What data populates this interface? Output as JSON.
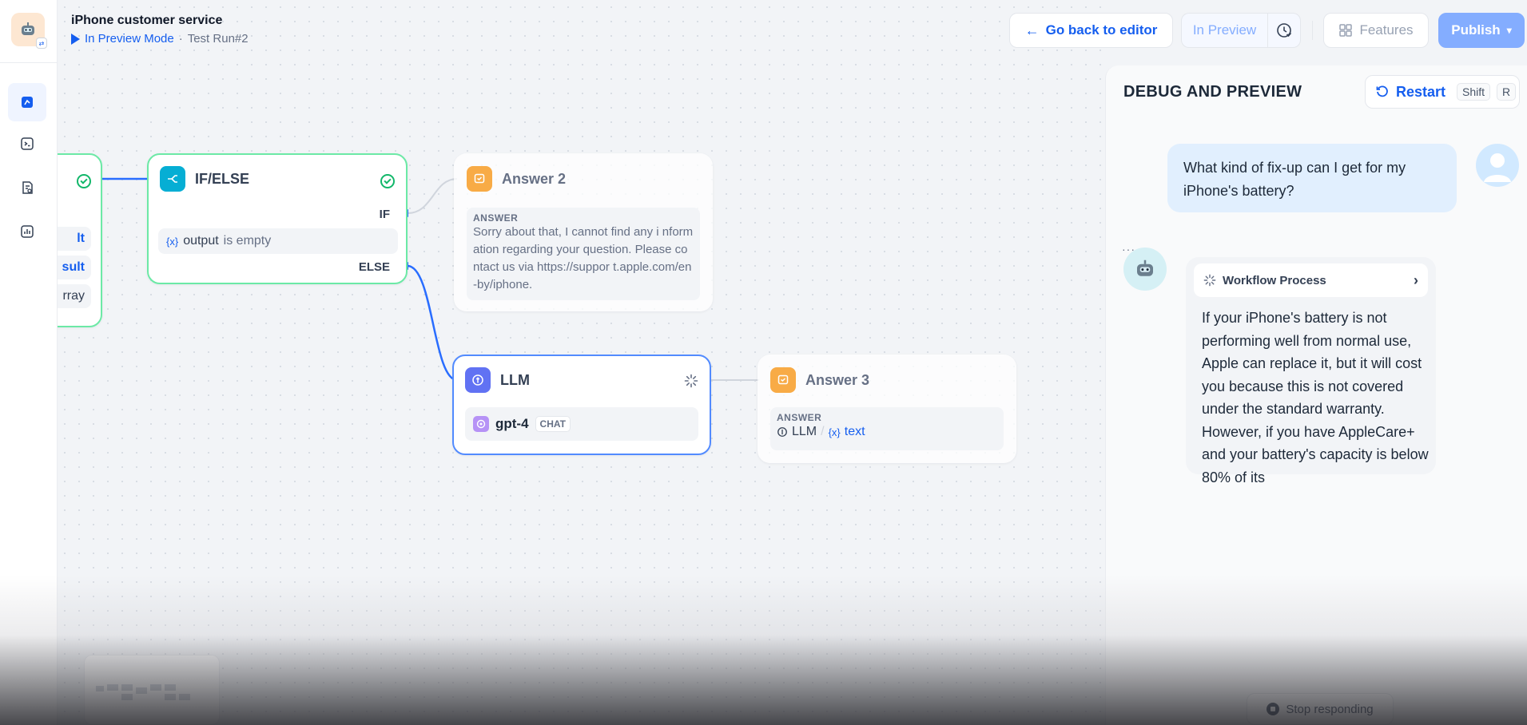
{
  "header": {
    "title": "iPhone customer service",
    "mode": "In Preview Mode",
    "separator": "·",
    "run": "Test Run#2",
    "go_back": "Go back to editor",
    "in_preview": "In Preview",
    "features": "Features",
    "publish": "Publish"
  },
  "nodes": {
    "prev": {
      "rows": [
        "lt",
        "sult",
        "rray"
      ]
    },
    "ifelse": {
      "title": "IF/ELSE",
      "if_label": "IF",
      "else_label": "ELSE",
      "condition_var": "output",
      "condition_op": "is empty"
    },
    "answer2": {
      "title": "Answer 2",
      "label": "ANSWER",
      "text": "Sorry about that, I cannot find any i nformation regarding your question. Please contact us via https://suppor t.apple.com/en-by/iphone."
    },
    "llm": {
      "title": "LLM",
      "model": "gpt-4",
      "mode": "CHAT"
    },
    "answer3": {
      "title": "Answer 3",
      "label": "ANSWER",
      "ref_node": "LLM",
      "ref_sep": "/",
      "ref_var": "text"
    }
  },
  "debug": {
    "title": "DEBUG AND PREVIEW",
    "restart": "Restart",
    "key1": "Shift",
    "key2": "R",
    "user_message": "What kind of fix-up can I get for my iPhone's battery?",
    "workflow_process": "Workflow Process",
    "bot_dots": "···",
    "bot_message": "If your iPhone's battery is not performing well from normal use, Apple can replace it, but it will cost you because this is not covered under the standard warranty. However, if you have AppleCare+ and your battery's capacity is below 80% of its",
    "stop": "Stop responding"
  },
  "colors": {
    "accent": "#155eef",
    "success": "#12b76a",
    "answer_icon": "#f79009",
    "ifelse_icon": "#06aed4",
    "llm_icon": "#6172f3",
    "publish_bg": "#84adff"
  }
}
